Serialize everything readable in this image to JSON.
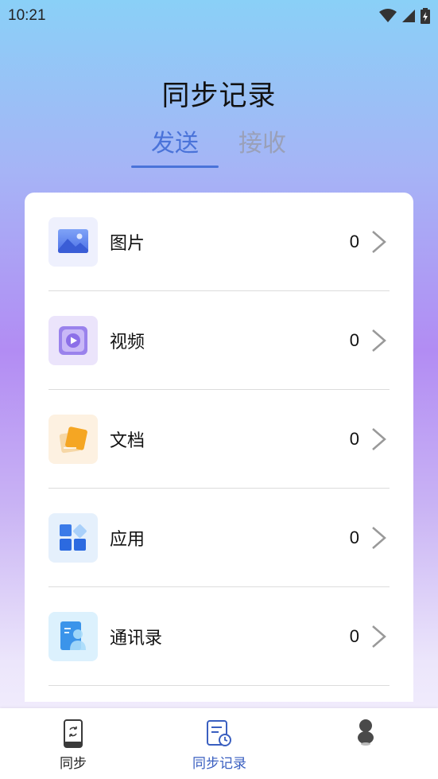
{
  "status_bar": {
    "time": "10:21"
  },
  "page_title": "同步记录",
  "tabs": [
    {
      "label": "发送",
      "active": true
    },
    {
      "label": "接收",
      "active": false
    }
  ],
  "items": [
    {
      "label": "图片",
      "count": "0",
      "icon": "image-icon"
    },
    {
      "label": "视频",
      "count": "0",
      "icon": "video-icon"
    },
    {
      "label": "文档",
      "count": "0",
      "icon": "document-icon"
    },
    {
      "label": "应用",
      "count": "0",
      "icon": "apps-icon"
    },
    {
      "label": "通讯录",
      "count": "0",
      "icon": "contacts-icon"
    }
  ],
  "bottom_nav": [
    {
      "label": "同步",
      "icon": "phone-sync-icon",
      "active": false
    },
    {
      "label": "同步记录",
      "icon": "records-icon",
      "active": true
    },
    {
      "label": "",
      "icon": "profile-icon",
      "active": false
    }
  ],
  "colors": {
    "accent": "#4a73d9",
    "inactive_tab": "#9aa0b8"
  }
}
